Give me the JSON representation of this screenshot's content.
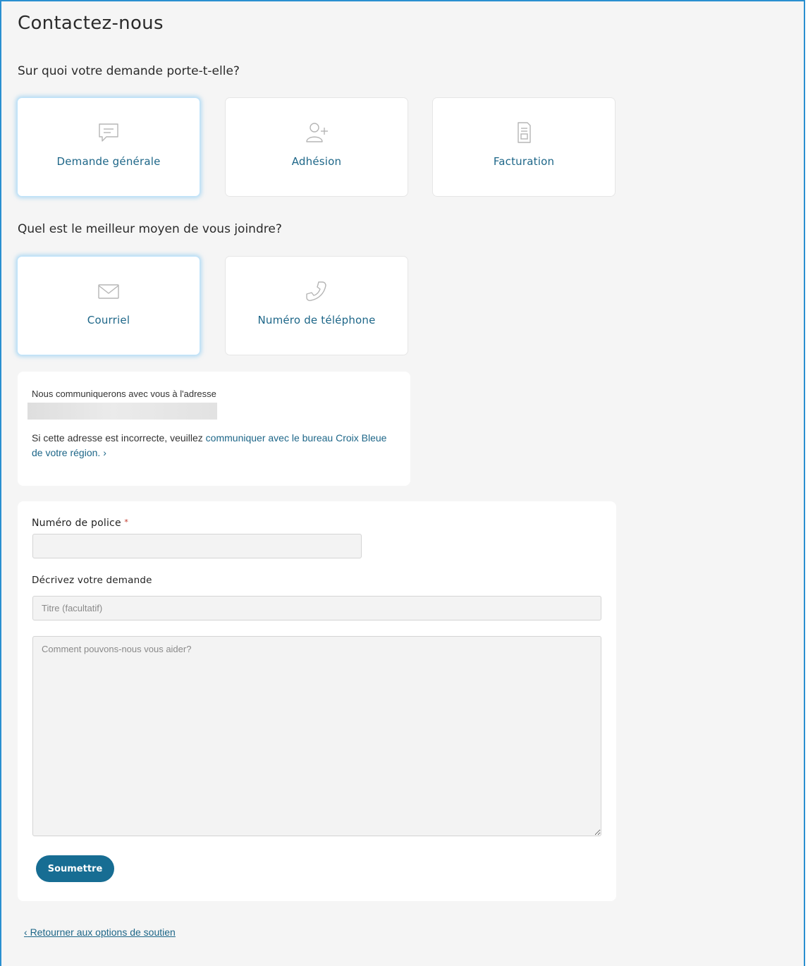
{
  "page": {
    "title": "Contactez-nous"
  },
  "topic": {
    "question": "Sur quoi votre demande porte-t-elle?",
    "options": [
      {
        "label": "Demande générale",
        "icon": "message-icon",
        "selected": true
      },
      {
        "label": "Adhésion",
        "icon": "add-user-icon",
        "selected": false
      },
      {
        "label": "Facturation",
        "icon": "document-icon",
        "selected": false
      }
    ]
  },
  "contact_method": {
    "question": "Quel est le meilleur moyen de vous joindre?",
    "options": [
      {
        "label": "Courriel",
        "icon": "envelope-icon",
        "selected": true
      },
      {
        "label": "Numéro de téléphone",
        "icon": "phone-icon",
        "selected": false
      }
    ]
  },
  "info": {
    "line1": "Nous communiquerons avec vous à l'adresse",
    "line2_prefix": "Si cette adresse est incorrecte, veuillez",
    "link": "communiquer avec le bureau Croix Bleue de votre région.",
    "link_chevron": "›"
  },
  "form": {
    "policy_label": "Numéro de police",
    "required_marker": "*",
    "policy_value": "",
    "describe_label": "Décrivez votre demande",
    "title_placeholder": "Titre (facultatif)",
    "message_placeholder": "Comment pouvons-nous vous aider?",
    "submit_label": "Soumettre"
  },
  "back_link": {
    "chevron": "‹",
    "label": "Retourner aux options de soutien"
  },
  "colors": {
    "accent": "#1d6688",
    "button": "#176d93",
    "frame": "#2a8fd0",
    "selected_glow": "#7dc4f0"
  }
}
